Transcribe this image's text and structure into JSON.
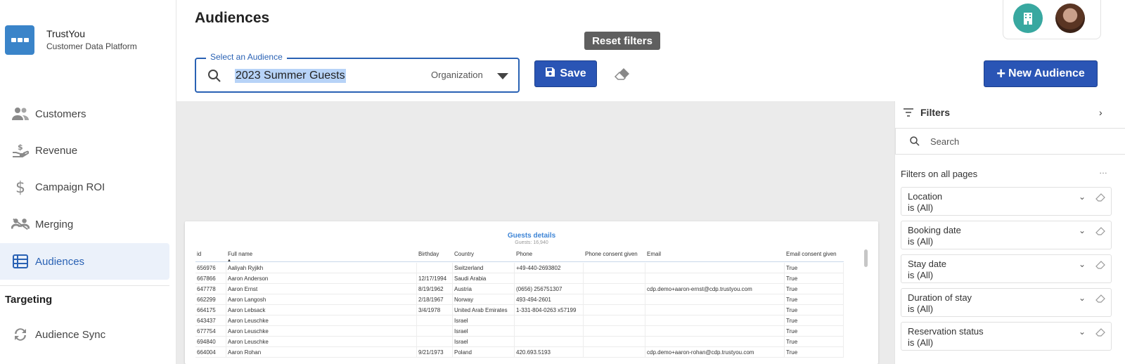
{
  "brand": {
    "name": "TrustYou",
    "subtitle": "Customer Data Platform"
  },
  "nav": [
    {
      "label": "Customers",
      "icon": "people-icon"
    },
    {
      "label": "Revenue",
      "icon": "hand-dollar-icon"
    },
    {
      "label": "Campaign ROI",
      "icon": "dollar-icon"
    },
    {
      "label": "Merging",
      "icon": "merge-people-icon"
    },
    {
      "label": "Audiences",
      "icon": "table-list-icon",
      "active": true
    }
  ],
  "targeting": {
    "title": "Targeting",
    "items": [
      {
        "label": "Audience Sync",
        "icon": "sync-icon"
      }
    ]
  },
  "header": {
    "title": "Audiences"
  },
  "audience_select": {
    "label": "Select an Audience",
    "value": "2023 Summer Guests",
    "scope": "Organization"
  },
  "toolbar": {
    "save_label": "Save",
    "reset_tooltip": "Reset filters",
    "new_label": "New Audience"
  },
  "colors": {
    "accent": "#2a55b5",
    "active_bg": "#ebf1fa",
    "org_avatar": "#38a8a0"
  },
  "report": {
    "title": "Guests details",
    "subtitle": "Guests: 16,940",
    "columns": [
      "id",
      "Full name",
      "Birthday",
      "Country",
      "Phone",
      "Phone consent given",
      "Email",
      "Email consent given"
    ],
    "rows": [
      [
        "656976",
        "Aaliyah Ryjikh",
        "",
        "Switzerland",
        "+49-440-2693802",
        "",
        "",
        "True"
      ],
      [
        "667866",
        "Aaron Anderson",
        "12/17/1994",
        "Saudi Arabia",
        "",
        "",
        "",
        "True"
      ],
      [
        "647778",
        "Aaron Ernst",
        "8/19/1962",
        "Austria",
        "(0656) 256751307",
        "",
        "cdp.demo+aaron-ernst@cdp.trustyou.com",
        "True"
      ],
      [
        "662299",
        "Aaron Langosh",
        "2/18/1967",
        "Norway",
        "493-494-2601",
        "",
        "",
        "True"
      ],
      [
        "664175",
        "Aaron Lebsack",
        "3/4/1978",
        "United Arab Emirates",
        "1-331-804-0263 x57199",
        "",
        "",
        "True"
      ],
      [
        "643437",
        "Aaron Leuschke",
        "",
        "Israel",
        "",
        "",
        "",
        "True"
      ],
      [
        "677754",
        "Aaron Leuschke",
        "",
        "Israel",
        "",
        "",
        "",
        "True"
      ],
      [
        "694840",
        "Aaron Leuschke",
        "",
        "Israel",
        "",
        "",
        "",
        "True"
      ],
      [
        "664004",
        "Aaron Rohan",
        "9/21/1973",
        "Poland",
        "420.693.5193",
        "",
        "cdp.demo+aaron-rohan@cdp.trustyou.com",
        "True"
      ]
    ]
  },
  "filters": {
    "title": "Filters",
    "search_placeholder": "Search",
    "section": "Filters on all pages",
    "items": [
      {
        "name": "Location",
        "value": "is (All)"
      },
      {
        "name": "Booking date",
        "value": "is (All)"
      },
      {
        "name": "Stay date",
        "value": "is (All)"
      },
      {
        "name": "Duration of stay",
        "value": "is (All)"
      },
      {
        "name": "Reservation status",
        "value": "is (All)"
      }
    ]
  }
}
